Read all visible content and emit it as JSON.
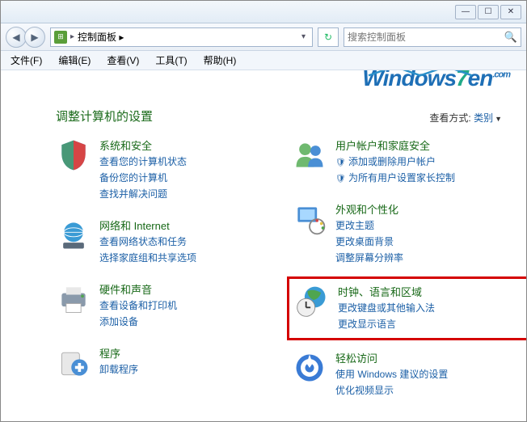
{
  "window": {
    "min": "—",
    "max": "☐",
    "close": "✕"
  },
  "nav": {
    "back": "◀",
    "forward": "▶",
    "breadcrumb": "控制面板 ▸",
    "drop": "▾",
    "refresh": "↻"
  },
  "search": {
    "placeholder": "搜索控制面板",
    "icon": "🔍"
  },
  "menu": {
    "file": "文件(F)",
    "edit": "编辑(E)",
    "view": "查看(V)",
    "tools": "工具(T)",
    "help": "帮助(H)"
  },
  "logo": {
    "w": "Windows",
    "s": "7",
    "en": "en",
    "com": ".com"
  },
  "heading": "调整计算机的设置",
  "viewmode": {
    "label": "查看方式:",
    "value": "类别"
  },
  "c": {
    "sys": {
      "title": "系统和安全",
      "l1": "查看您的计算机状态",
      "l2": "备份您的计算机",
      "l3": "查找并解决问题"
    },
    "net": {
      "title": "网络和 Internet",
      "l1": "查看网络状态和任务",
      "l2": "选择家庭组和共享选项"
    },
    "hw": {
      "title": "硬件和声音",
      "l1": "查看设备和打印机",
      "l2": "添加设备"
    },
    "prog": {
      "title": "程序",
      "l1": "卸载程序"
    },
    "user": {
      "title": "用户帐户和家庭安全",
      "l1": "添加或删除用户帐户",
      "l2": "为所有用户设置家长控制"
    },
    "app": {
      "title": "外观和个性化",
      "l1": "更改主题",
      "l2": "更改桌面背景",
      "l3": "调整屏幕分辨率"
    },
    "clk": {
      "title": "时钟、语言和区域",
      "l1": "更改键盘或其他输入法",
      "l2": "更改显示语言"
    },
    "ease": {
      "title": "轻松访问",
      "l1": "使用 Windows 建议的设置",
      "l2": "优化视频显示"
    }
  }
}
